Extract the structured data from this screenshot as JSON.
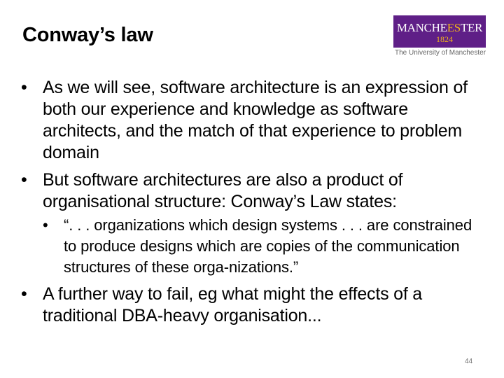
{
  "title": "Conway’s law",
  "logo": {
    "word_start": "MANCHE",
    "word_accent": "ES",
    "word_end": "TER",
    "year": "1824",
    "university": "The University of Manchester",
    "purple": "#5f1f87",
    "gold": "#f0b31b"
  },
  "bullet_marker": "•",
  "bullets": [
    {
      "text": "As we will see, software architecture is an expression of both our experience and knowledge as software architects, and the match of that experience to problem domain"
    },
    {
      "text": "But software architectures are also a product of organisational structure: Conway’s Law states:",
      "sub": [
        "“. . . organizations which design systems . . . are constrained to produce designs which are copies of the communication structures of these orga-nizations.”"
      ]
    },
    {
      "text": "A further way to fail, eg what might the effects of a traditional DBA-heavy organisation..."
    }
  ],
  "page_number": "44"
}
